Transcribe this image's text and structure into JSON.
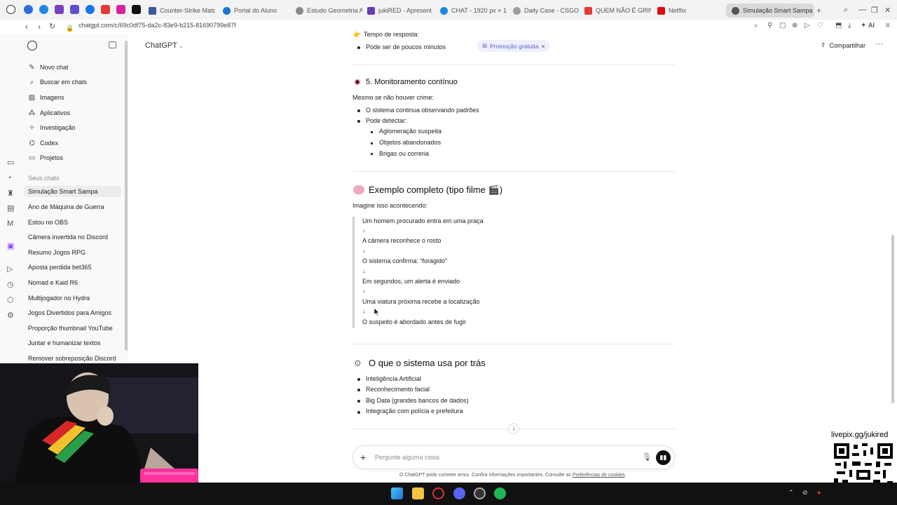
{
  "browser": {
    "tabs": [
      {
        "label": "Counter-Strike Matc"
      },
      {
        "label": "Portal do Aluno"
      },
      {
        "label": "Estudo Geometria A"
      },
      {
        "label": "jukiRED - Apresent"
      },
      {
        "label": "CHAT - 1920 px × 1"
      },
      {
        "label": "Daily Case - CSGO"
      },
      {
        "label": "QUEM NÃO É GRIN"
      },
      {
        "label": "Netflix"
      },
      {
        "label": "Simulação Smart Sampa"
      }
    ],
    "url": "chatgpt.com/c/69c0df75-da2c-83e9-b215-81690799e87f",
    "ai_label": "AI"
  },
  "sidebar": {
    "nav": [
      {
        "label": "Novo chat",
        "icon": "edit-icon"
      },
      {
        "label": "Buscar em chats",
        "icon": "search-icon"
      },
      {
        "label": "Imagens",
        "icon": "image-icon"
      },
      {
        "label": "Aplicativos",
        "icon": "apps-icon"
      },
      {
        "label": "Investigação",
        "icon": "research-icon"
      },
      {
        "label": "Codex",
        "icon": "codex-icon"
      },
      {
        "label": "Projetos",
        "icon": "folder-icon"
      }
    ],
    "section_label": "Seus chats",
    "chats": [
      "Simulação Smart Sampa",
      "Ano de Máquina de Guerra",
      "Estou no OBS",
      "Câmera invertida no Discord",
      "Resumo Jogos RPG",
      "Aposta perdida bet365",
      "Nomad e Kaid R6",
      "Multijogador no Hydra",
      "Jogos Divertidos para Amigos",
      "Proporção thumbnail YouTube",
      "Juntar e humanizar textos",
      "Remover sobreposição Discord"
    ]
  },
  "header": {
    "model": "ChatGPT",
    "promo": "Promoção gratuita",
    "share": "Compartilhar"
  },
  "conversation": {
    "partial_top": "Tempo de resposta:",
    "partial_bullet": "Pode ser de poucos minutos",
    "section5": {
      "title": "5. Monitoramento contínuo",
      "intro": "Mesmo se não houver crime:",
      "bullets": [
        "O sistema continua observando padrões",
        "Pode detectar:"
      ],
      "sub_bullets": [
        "Aglomeração suspeita",
        "Objetos abandonados",
        "Brigas ou correria"
      ]
    },
    "example": {
      "title": "Exemplo completo (tipo filme 🎬)",
      "intro": "Imagine isso acontecendo:",
      "steps": [
        "Um homem procurado entra em uma praça",
        "A câmera reconhece o rosto",
        "O sistema confirma: “foragido”",
        "Em segundos, um alerta é enviado",
        "Uma viatura próxima recebe a localização",
        "O suspeito é abordado antes de fugir"
      ],
      "arrow": "↓"
    },
    "uses": {
      "title": "O que o sistema usa por trás",
      "bullets": [
        "Inteligência Artificial",
        "Reconhecimento facial",
        "Big Data (grandes bancos de dados)",
        "Integração com polícia e prefeitura"
      ]
    }
  },
  "composer": {
    "placeholder": "Pergunte alguma coisa"
  },
  "footer": {
    "disclaimer": "O ChatGPT pode cometer erros. Confira informações importantes. Consulte as",
    "link": "Preferências de cookies",
    "end": "."
  },
  "overlay": {
    "livepix": "livepix.gg/jukired"
  },
  "colors": {
    "promo_bg": "#eef0ff",
    "promo_text": "#5b5fc7",
    "send_button": "#0d0d0d"
  }
}
